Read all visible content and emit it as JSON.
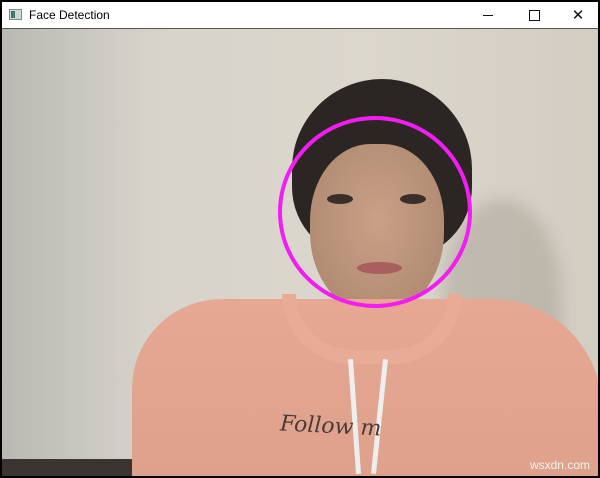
{
  "window": {
    "title": "Face Detection",
    "icons": {
      "app": "opencv-window-icon",
      "minimize": "minimize-icon",
      "maximize": "maximize-icon",
      "close": "close-icon"
    }
  },
  "view": {
    "shirt_print": "Follow m",
    "detection_color": "#f01ef0",
    "watermark": "wsxdn.com"
  }
}
